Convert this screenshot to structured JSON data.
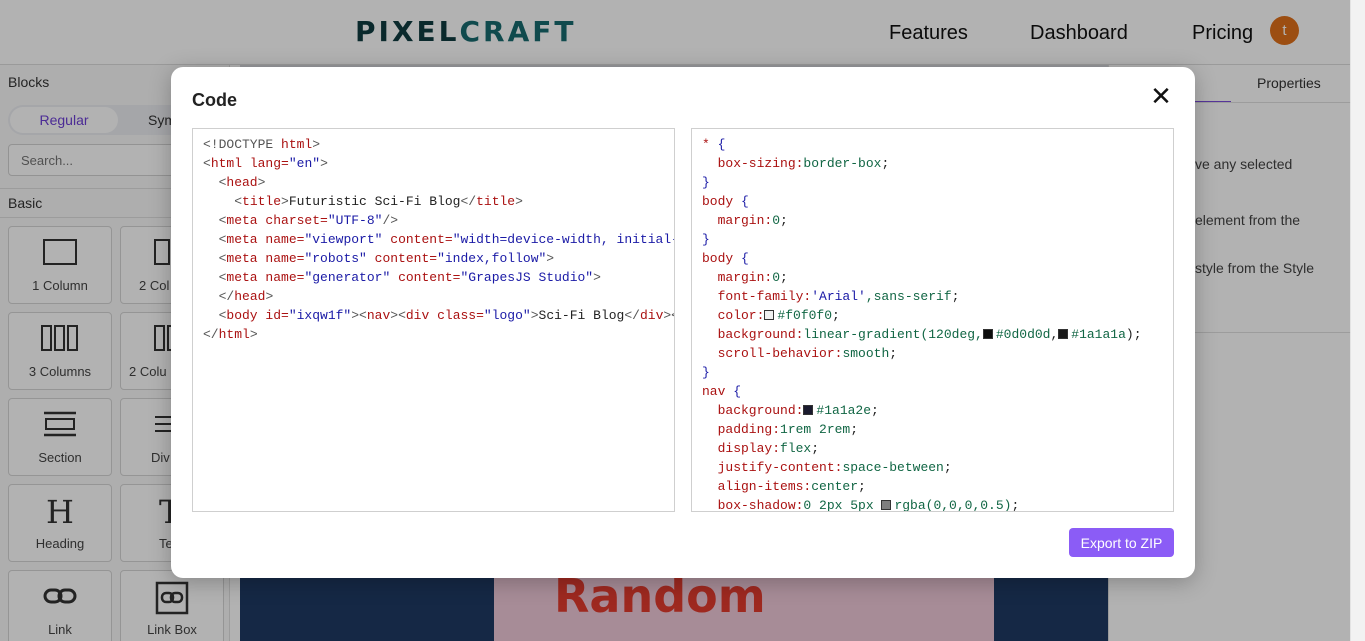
{
  "app": {
    "logo_part1": "PIXEL",
    "logo_part2": "CRAFT",
    "nav": [
      "Features",
      "Dashboard",
      "Pricing"
    ],
    "avatar_initial": "t"
  },
  "blocks_panel": {
    "title": "Blocks",
    "tabs": [
      "Regular",
      "Sym"
    ],
    "search_placeholder": "Search...",
    "category": "Basic",
    "blocks": [
      {
        "label": "1 Column",
        "icon": "one-column-icon"
      },
      {
        "label": "2 Col",
        "icon": "two-column-icon"
      },
      {
        "label": "3 Columns",
        "icon": "three-columns-icon"
      },
      {
        "label": "2 Colu",
        "icon": "two-columns-3-7-icon"
      },
      {
        "label": "Section",
        "icon": "section-icon"
      },
      {
        "label": "Div",
        "icon": "divider-icon"
      },
      {
        "label": "Heading",
        "icon": "heading-icon"
      },
      {
        "label": "Te",
        "icon": "text-icon"
      },
      {
        "label": "Link",
        "icon": "link-icon"
      },
      {
        "label": "Link Box",
        "icon": "link-box-icon"
      }
    ]
  },
  "canvas": {
    "poster_text": "Random"
  },
  "properties_panel": {
    "tab": "Properties",
    "hint_lines": [
      "ve any selected",
      "element from the",
      "style from the Style"
    ]
  },
  "modal": {
    "title": "Code",
    "close_label": "✕",
    "export_label": "Export to ZIP",
    "html_lines": [
      [
        {
          "t": "<!DOCTYPE ",
          "c": "ang"
        },
        {
          "t": "html",
          "c": "tag"
        },
        {
          "t": ">",
          "c": "ang"
        }
      ],
      [
        {
          "t": "<",
          "c": "ang"
        },
        {
          "t": "html ",
          "c": "tag"
        },
        {
          "t": "lang=",
          "c": "attr"
        },
        {
          "t": "\"en\"",
          "c": "aval"
        },
        {
          "t": ">",
          "c": "ang"
        }
      ],
      [
        {
          "t": "  <",
          "c": "ang"
        },
        {
          "t": "head",
          "c": "tag"
        },
        {
          "t": ">",
          "c": "ang"
        }
      ],
      [
        {
          "t": "    <",
          "c": "ang"
        },
        {
          "t": "title",
          "c": "tag"
        },
        {
          "t": ">",
          "c": "ang"
        },
        {
          "t": "Futuristic Sci-Fi Blog",
          "c": ""
        },
        {
          "t": "</",
          "c": "ang"
        },
        {
          "t": "title",
          "c": "tag"
        },
        {
          "t": ">",
          "c": "ang"
        }
      ],
      [
        {
          "t": "  <",
          "c": "ang"
        },
        {
          "t": "meta ",
          "c": "tag"
        },
        {
          "t": "charset=",
          "c": "attr"
        },
        {
          "t": "\"UTF-8\"",
          "c": "aval"
        },
        {
          "t": "/>",
          "c": "ang"
        }
      ],
      [
        {
          "t": "  <",
          "c": "ang"
        },
        {
          "t": "meta ",
          "c": "tag"
        },
        {
          "t": "name=",
          "c": "attr"
        },
        {
          "t": "\"viewport\" ",
          "c": "aval"
        },
        {
          "t": "content=",
          "c": "attr"
        },
        {
          "t": "\"width=device-width, initial-",
          "c": "aval"
        }
      ],
      [
        {
          "t": "  <",
          "c": "ang"
        },
        {
          "t": "meta ",
          "c": "tag"
        },
        {
          "t": "name=",
          "c": "attr"
        },
        {
          "t": "\"robots\" ",
          "c": "aval"
        },
        {
          "t": "content=",
          "c": "attr"
        },
        {
          "t": "\"index,follow\"",
          "c": "aval"
        },
        {
          "t": ">",
          "c": "ang"
        }
      ],
      [
        {
          "t": "  <",
          "c": "ang"
        },
        {
          "t": "meta ",
          "c": "tag"
        },
        {
          "t": "name=",
          "c": "attr"
        },
        {
          "t": "\"generator\" ",
          "c": "aval"
        },
        {
          "t": "content=",
          "c": "attr"
        },
        {
          "t": "\"GrapesJS Studio\"",
          "c": "aval"
        },
        {
          "t": ">",
          "c": "ang"
        }
      ],
      [
        {
          "t": "  </",
          "c": "ang"
        },
        {
          "t": "head",
          "c": "tag"
        },
        {
          "t": ">",
          "c": "ang"
        }
      ],
      [
        {
          "t": "  <",
          "c": "ang"
        },
        {
          "t": "body ",
          "c": "tag"
        },
        {
          "t": "id=",
          "c": "attr"
        },
        {
          "t": "\"ixqw1f\"",
          "c": "aval"
        },
        {
          "t": "><",
          "c": "ang"
        },
        {
          "t": "nav",
          "c": "tag"
        },
        {
          "t": "><",
          "c": "ang"
        },
        {
          "t": "div ",
          "c": "tag"
        },
        {
          "t": "class=",
          "c": "attr"
        },
        {
          "t": "\"logo\"",
          "c": "aval"
        },
        {
          "t": ">",
          "c": "ang"
        },
        {
          "t": "Sci-Fi Blog",
          "c": ""
        },
        {
          "t": "</",
          "c": "ang"
        },
        {
          "t": "div",
          "c": "tag"
        },
        {
          "t": "><",
          "c": "ang"
        }
      ],
      [
        {
          "t": "</",
          "c": "ang"
        },
        {
          "t": "html",
          "c": "tag"
        },
        {
          "t": ">",
          "c": "ang"
        }
      ]
    ],
    "css_lines": [
      [
        {
          "t": "* ",
          "c": "sel"
        },
        {
          "t": "{",
          "c": "brc"
        }
      ],
      [
        {
          "t": "  box-sizing:",
          "c": "prop"
        },
        {
          "t": "border-box",
          "c": "val"
        },
        {
          "t": ";",
          "c": ""
        }
      ],
      [
        {
          "t": "}",
          "c": "brc"
        }
      ],
      [
        {
          "t": "body ",
          "c": "sel"
        },
        {
          "t": "{",
          "c": "brc"
        }
      ],
      [
        {
          "t": "  margin:",
          "c": "prop"
        },
        {
          "t": "0",
          "c": "val"
        },
        {
          "t": ";",
          "c": ""
        }
      ],
      [
        {
          "t": "}",
          "c": "brc"
        }
      ],
      [
        {
          "t": "body ",
          "c": "sel"
        },
        {
          "t": "{",
          "c": "brc"
        }
      ],
      [
        {
          "t": "  margin:",
          "c": "prop"
        },
        {
          "t": "0",
          "c": "val"
        },
        {
          "t": ";",
          "c": ""
        }
      ],
      [
        {
          "t": "  font-family:",
          "c": "prop"
        },
        {
          "t": "'Arial'",
          "c": "aval"
        },
        {
          "t": ",sans-serif",
          "c": "val"
        },
        {
          "t": ";",
          "c": ""
        }
      ],
      [
        {
          "t": "  color:",
          "c": "prop"
        },
        {
          "sw": "#f0f0f0"
        },
        {
          "t": "#f0f0f0",
          "c": "val"
        },
        {
          "t": ";",
          "c": ""
        }
      ],
      [
        {
          "t": "  background:",
          "c": "prop"
        },
        {
          "t": "linear-gradient(120deg,",
          "c": "val"
        },
        {
          "sw": "#0d0d0d"
        },
        {
          "t": "#0d0d0d",
          "c": "val"
        },
        {
          "t": ",",
          "c": ""
        },
        {
          "sw": "#1a1a1a"
        },
        {
          "t": "#1a1a1a",
          "c": "val"
        },
        {
          "t": ");",
          "c": ""
        }
      ],
      [
        {
          "t": "  scroll-behavior:",
          "c": "prop"
        },
        {
          "t": "smooth",
          "c": "val"
        },
        {
          "t": ";",
          "c": ""
        }
      ],
      [
        {
          "t": "}",
          "c": "brc"
        }
      ],
      [
        {
          "t": "nav ",
          "c": "sel"
        },
        {
          "t": "{",
          "c": "brc"
        }
      ],
      [
        {
          "t": "  background:",
          "c": "prop"
        },
        {
          "sw": "#1a1a2e"
        },
        {
          "t": "#1a1a2e",
          "c": "val"
        },
        {
          "t": ";",
          "c": ""
        }
      ],
      [
        {
          "t": "  padding:",
          "c": "prop"
        },
        {
          "t": "1rem 2rem",
          "c": "val"
        },
        {
          "t": ";",
          "c": ""
        }
      ],
      [
        {
          "t": "  display:",
          "c": "prop"
        },
        {
          "t": "flex",
          "c": "val"
        },
        {
          "t": ";",
          "c": ""
        }
      ],
      [
        {
          "t": "  justify-content:",
          "c": "prop"
        },
        {
          "t": "space-between",
          "c": "val"
        },
        {
          "t": ";",
          "c": ""
        }
      ],
      [
        {
          "t": "  align-items:",
          "c": "prop"
        },
        {
          "t": "center",
          "c": "val"
        },
        {
          "t": ";",
          "c": ""
        }
      ],
      [
        {
          "t": "  box-shadow:",
          "c": "prop"
        },
        {
          "t": "0 2px 5px ",
          "c": "val"
        },
        {
          "sw": "rgba(0,0,0,0.5)"
        },
        {
          "t": "rgba(0,0,0,0.5)",
          "c": "val"
        },
        {
          "t": ";",
          "c": ""
        }
      ]
    ]
  }
}
